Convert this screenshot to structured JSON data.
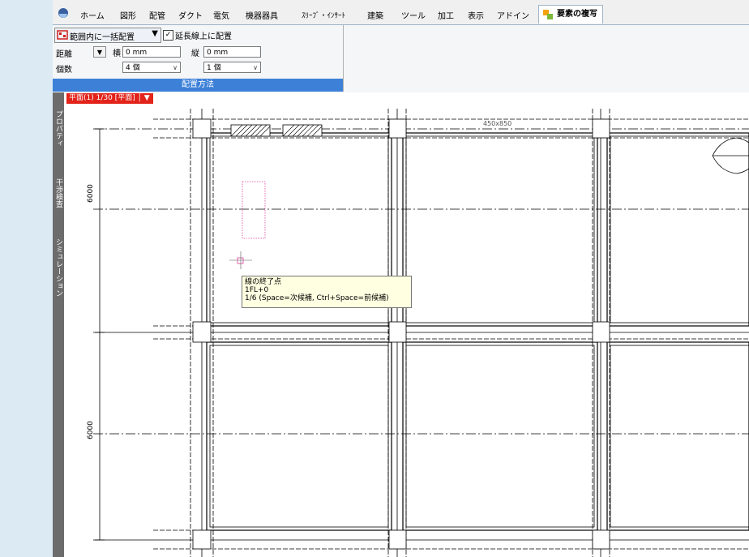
{
  "tabs": {
    "items": [
      {
        "label": "ホーム"
      },
      {
        "label": "図形"
      },
      {
        "label": "配管"
      },
      {
        "label": "ダクト"
      },
      {
        "label": "電気"
      },
      {
        "label": "機器器具"
      },
      {
        "label": "ｽﾘｰﾌﾞ・ｲﾝｻｰﾄ"
      },
      {
        "label": "建築"
      },
      {
        "label": "ツール"
      },
      {
        "label": "加工"
      },
      {
        "label": "表示"
      },
      {
        "label": "アドイン"
      }
    ],
    "active": {
      "label": "要素の複写"
    }
  },
  "ribbon": {
    "mode_label": "範囲内に一括配置",
    "checkbox_label": "延長線上に配置",
    "checkbox_checked": "✓",
    "distance_label": "距離",
    "horizontal_label": "横",
    "horizontal_value": "0 mm",
    "vertical_label": "縦",
    "vertical_value": "0 mm",
    "count_label": "個数",
    "count_horizontal": "4 個",
    "count_vertical": "1 個",
    "group_caption": "配置方法"
  },
  "side_tabs": [
    {
      "label": "プロパティ"
    },
    {
      "label": "干渉検査"
    },
    {
      "label": "シミュレーション"
    }
  ],
  "view": {
    "tab_label": "平面(1) 1/30 [平面]",
    "dimension_top": "450x850",
    "dimension_left_1": "6000",
    "dimension_left_2": "6000"
  },
  "tooltip": {
    "line1": "線の終了点",
    "line2": "1FL+0",
    "line3": "1/6 (Space=次候補, Ctrl+Space=前候補)"
  },
  "colors": {
    "active_caption": "#3d80d8",
    "view_tab": "#e2231a",
    "tooltip_bg": "#ffffe1",
    "preview": "#e0409a"
  }
}
